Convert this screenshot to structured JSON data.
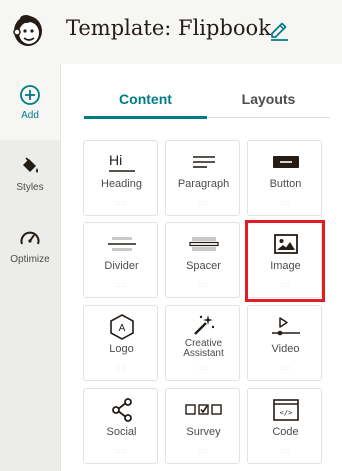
{
  "header": {
    "title": "Template: Flipbook",
    "logo_icon": "freddie-logo-icon",
    "edit_icon": "pencil-icon"
  },
  "rail": {
    "items": [
      {
        "label": "Add",
        "icon": "plus-circle-icon"
      },
      {
        "label": "Styles",
        "icon": "paint-bucket-icon"
      },
      {
        "label": "Optimize",
        "icon": "gauge-icon"
      }
    ]
  },
  "tabs": [
    {
      "label": "Content",
      "active": true
    },
    {
      "label": "Layouts",
      "active": false
    }
  ],
  "blocks": [
    {
      "label": "Heading",
      "icon": "heading-icon"
    },
    {
      "label": "Paragraph",
      "icon": "paragraph-icon"
    },
    {
      "label": "Button",
      "icon": "button-block-icon"
    },
    {
      "label": "Divider",
      "icon": "divider-icon"
    },
    {
      "label": "Spacer",
      "icon": "spacer-icon"
    },
    {
      "label": "Image",
      "icon": "image-icon",
      "highlighted": true
    },
    {
      "label": "Logo",
      "icon": "logo-hexagon-icon"
    },
    {
      "label_line1": "Creative",
      "label_line2": "Assistant",
      "icon": "magic-wand-icon"
    },
    {
      "label": "Video",
      "icon": "video-play-icon"
    },
    {
      "label": "Social",
      "icon": "share-icon"
    },
    {
      "label": "Survey",
      "icon": "survey-checkbox-icon"
    },
    {
      "label": "Code",
      "icon": "code-icon"
    }
  ],
  "heading_glyph": "Hi",
  "logo_glyph": "A",
  "code_glyph": "</>",
  "grip_glyph": "::::",
  "colors": {
    "accent": "#007c89",
    "text": "#241c15",
    "highlight": "#e31c24"
  }
}
